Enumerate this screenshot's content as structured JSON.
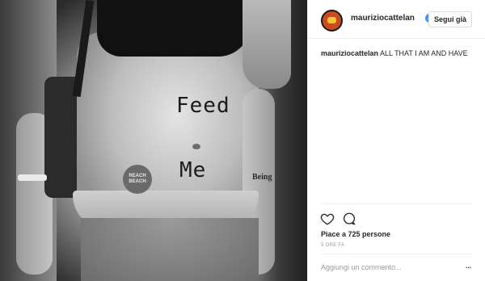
{
  "post": {
    "photo": {
      "body_text": [
        "Feed",
        "Me"
      ],
      "sticker_text": "REACH\nBEACH",
      "tattoo_text": "Being"
    },
    "header": {
      "username": "mauriziocattelan",
      "verified_icon": "verified-badge-icon",
      "follow_label": "Segui già"
    },
    "caption": {
      "username": "mauriziocattelan",
      "text": "ALL THAT I AM AND HAVE"
    },
    "actions": {
      "like_icon": "heart-icon",
      "comment_icon": "comment-bubble-icon"
    },
    "likes_text": "Piace a 725 persone",
    "timestamp": "5 ORE FA",
    "comment": {
      "placeholder": "Aggiungi un commento...",
      "more_label": "..."
    }
  },
  "colors": {
    "accent_verified": "#3897f0",
    "text_primary": "#262626",
    "text_muted": "#999999",
    "divider": "#efefef"
  }
}
